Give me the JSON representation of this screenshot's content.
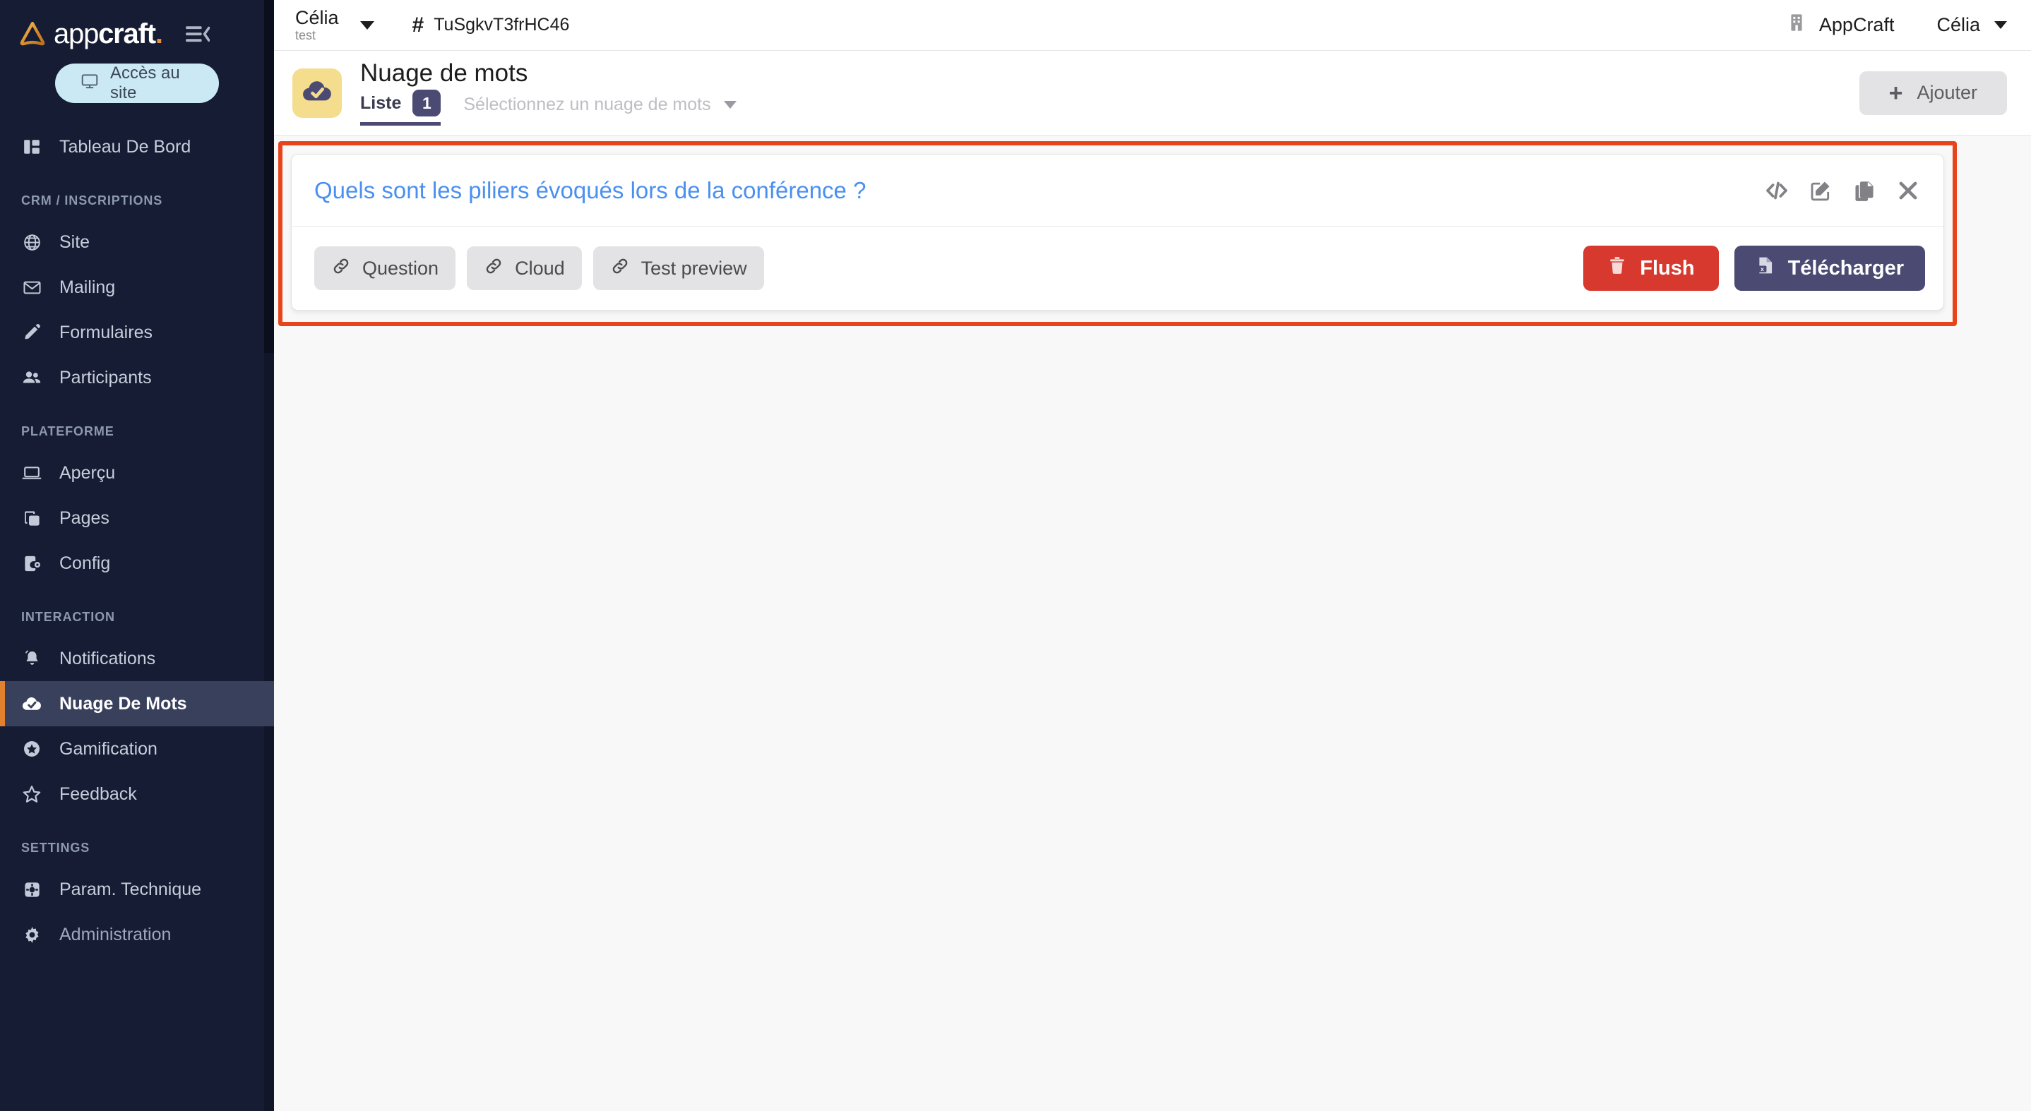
{
  "sidebar": {
    "brand": {
      "name_light": "app",
      "name_bold": "craft",
      "dot": ".",
      "logo_icon": "appcraft-triangle-logo",
      "collapse_icon": "collapse-sidebar-icon"
    },
    "access_button": {
      "label": "Accès au site",
      "icon": "monitor-icon"
    },
    "groups": [
      {
        "label": "",
        "items": [
          {
            "label": "Tableau De Bord",
            "icon": "dashboard-icon",
            "active": false
          }
        ]
      },
      {
        "label": "CRM / INSCRIPTIONS",
        "items": [
          {
            "label": "Site",
            "icon": "globe-icon",
            "active": false
          },
          {
            "label": "Mailing",
            "icon": "mail-icon",
            "active": false
          },
          {
            "label": "Formulaires",
            "icon": "pencil-icon",
            "active": false
          },
          {
            "label": "Participants",
            "icon": "people-icon",
            "active": false
          }
        ]
      },
      {
        "label": "PLATEFORME",
        "items": [
          {
            "label": "Aperçu",
            "icon": "laptop-icon",
            "active": false
          },
          {
            "label": "Pages",
            "icon": "pages-icon",
            "active": false
          },
          {
            "label": "Config",
            "icon": "mobile-config-icon",
            "active": false
          }
        ]
      },
      {
        "label": "INTERACTION",
        "items": [
          {
            "label": "Notifications",
            "icon": "bell-icon",
            "active": false
          },
          {
            "label": "Nuage De Mots",
            "icon": "cloud-check-icon",
            "active": true
          },
          {
            "label": "Gamification",
            "icon": "star-circle-icon",
            "active": false
          },
          {
            "label": "Feedback",
            "icon": "star-outline-icon",
            "active": false
          }
        ]
      },
      {
        "label": "SETTINGS",
        "items": [
          {
            "label": "Param. Technique",
            "icon": "settings-square-icon",
            "active": false
          },
          {
            "label": "Administration",
            "icon": "gear-icon",
            "active": false
          }
        ]
      }
    ]
  },
  "topbar": {
    "event_name": "Célia",
    "event_sub": "test",
    "event_dropdown_icon": "chevron-down-icon",
    "hash_symbol": "#",
    "event_code": "TuSgkvT3frHC46",
    "org_icon": "building-icon",
    "org_name": "AppCraft",
    "user_name": "Célia",
    "user_dropdown_icon": "chevron-down-icon"
  },
  "pagehead": {
    "app_icon": "cloud-check-icon",
    "title": "Nuage de mots",
    "tab_label": "Liste",
    "tab_badge": "1",
    "select_placeholder": "Sélectionnez un nuage de mots",
    "select_caret_icon": "chevron-down-icon",
    "add_button": {
      "label": "Ajouter",
      "icon": "plus-icon"
    }
  },
  "card": {
    "question": "Quels sont les piliers évoqués lors de la conférence ?",
    "header_actions": [
      {
        "name": "embed-code",
        "icon": "code-icon"
      },
      {
        "name": "edit",
        "icon": "edit-icon"
      },
      {
        "name": "duplicate",
        "icon": "copy-icon"
      },
      {
        "name": "delete",
        "icon": "close-icon"
      }
    ],
    "link_buttons": [
      {
        "label": "Question",
        "icon": "link-icon"
      },
      {
        "label": "Cloud",
        "icon": "link-icon"
      },
      {
        "label": "Test preview",
        "icon": "link-icon"
      }
    ],
    "flush_button": {
      "label": "Flush",
      "icon": "trash-icon"
    },
    "download_button": {
      "label": "Télécharger",
      "icon": "excel-file-icon"
    }
  },
  "colors": {
    "sidebar_bg": "#151c33",
    "sidebar_active_bg": "#39405C",
    "accent_orange": "#E2822F",
    "highlight_red": "#E8441C",
    "link_blue": "#4A90F0",
    "brand_slate": "#4A4A73",
    "flush_red": "#D8392F",
    "app_icon_yellow": "#F5DD8E",
    "access_blue": "#CBE9F5"
  }
}
